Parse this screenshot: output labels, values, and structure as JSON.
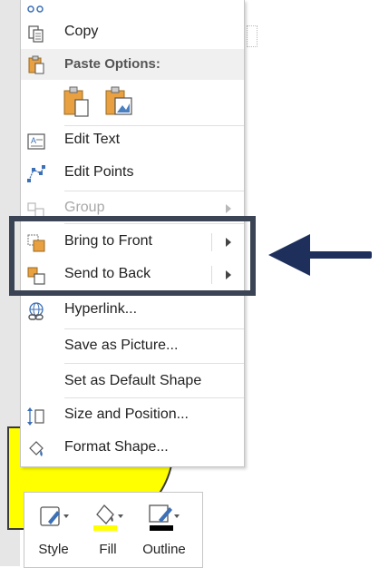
{
  "menu": {
    "items": [
      {
        "key": "copy",
        "label": "Copy",
        "icon": "copy-icon"
      },
      {
        "key": "paste_options",
        "label": "Paste Options:",
        "icon": "paste-icon"
      },
      {
        "key": "edit_text",
        "label": "Edit Text",
        "icon": "edit-text-icon"
      },
      {
        "key": "edit_points",
        "label": "Edit Points",
        "icon": "edit-points-icon"
      },
      {
        "key": "group",
        "label": "Group",
        "icon": "group-icon",
        "disabled": true,
        "submenu": true
      },
      {
        "key": "bring_to_front",
        "label": "Bring to Front",
        "icon": "bring-to-front-icon",
        "submenu": true
      },
      {
        "key": "send_to_back",
        "label": "Send to Back",
        "icon": "send-to-back-icon",
        "submenu": true
      },
      {
        "key": "hyperlink",
        "label": "Hyperlink...",
        "icon": "hyperlink-icon"
      },
      {
        "key": "save_as_picture",
        "label": "Save as Picture...",
        "icon": ""
      },
      {
        "key": "set_default_shape",
        "label": "Set as Default Shape",
        "icon": ""
      },
      {
        "key": "size_position",
        "label": "Size and Position...",
        "icon": "size-position-icon"
      },
      {
        "key": "format_shape",
        "label": "Format Shape...",
        "icon": "format-shape-icon"
      }
    ]
  },
  "toolbar": {
    "buttons": [
      {
        "key": "style",
        "label": "Style",
        "icon": "shape-style-icon"
      },
      {
        "key": "fill",
        "label": "Fill",
        "icon": "fill-bucket-icon",
        "color": "#ffff00"
      },
      {
        "key": "outline",
        "label": "Outline",
        "icon": "outline-pen-icon",
        "color": "#000000"
      }
    ]
  },
  "colors": {
    "highlight_border": "#3a4454",
    "callout_arrow": "#1e2f5c",
    "shape_fill": "#ffff00"
  }
}
